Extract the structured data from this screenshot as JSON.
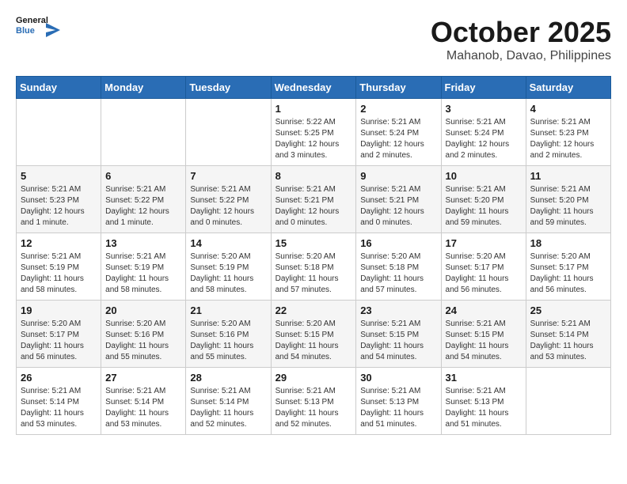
{
  "logo": {
    "line1": "General",
    "line2": "Blue"
  },
  "header": {
    "month": "October 2025",
    "location": "Mahanob, Davao, Philippines"
  },
  "weekdays": [
    "Sunday",
    "Monday",
    "Tuesday",
    "Wednesday",
    "Thursday",
    "Friday",
    "Saturday"
  ],
  "weeks": [
    [
      {
        "day": "",
        "info": ""
      },
      {
        "day": "",
        "info": ""
      },
      {
        "day": "",
        "info": ""
      },
      {
        "day": "1",
        "info": "Sunrise: 5:22 AM\nSunset: 5:25 PM\nDaylight: 12 hours and 3 minutes."
      },
      {
        "day": "2",
        "info": "Sunrise: 5:21 AM\nSunset: 5:24 PM\nDaylight: 12 hours and 2 minutes."
      },
      {
        "day": "3",
        "info": "Sunrise: 5:21 AM\nSunset: 5:24 PM\nDaylight: 12 hours and 2 minutes."
      },
      {
        "day": "4",
        "info": "Sunrise: 5:21 AM\nSunset: 5:23 PM\nDaylight: 12 hours and 2 minutes."
      }
    ],
    [
      {
        "day": "5",
        "info": "Sunrise: 5:21 AM\nSunset: 5:23 PM\nDaylight: 12 hours and 1 minute."
      },
      {
        "day": "6",
        "info": "Sunrise: 5:21 AM\nSunset: 5:22 PM\nDaylight: 12 hours and 1 minute."
      },
      {
        "day": "7",
        "info": "Sunrise: 5:21 AM\nSunset: 5:22 PM\nDaylight: 12 hours and 0 minutes."
      },
      {
        "day": "8",
        "info": "Sunrise: 5:21 AM\nSunset: 5:21 PM\nDaylight: 12 hours and 0 minutes."
      },
      {
        "day": "9",
        "info": "Sunrise: 5:21 AM\nSunset: 5:21 PM\nDaylight: 12 hours and 0 minutes."
      },
      {
        "day": "10",
        "info": "Sunrise: 5:21 AM\nSunset: 5:20 PM\nDaylight: 11 hours and 59 minutes."
      },
      {
        "day": "11",
        "info": "Sunrise: 5:21 AM\nSunset: 5:20 PM\nDaylight: 11 hours and 59 minutes."
      }
    ],
    [
      {
        "day": "12",
        "info": "Sunrise: 5:21 AM\nSunset: 5:19 PM\nDaylight: 11 hours and 58 minutes."
      },
      {
        "day": "13",
        "info": "Sunrise: 5:21 AM\nSunset: 5:19 PM\nDaylight: 11 hours and 58 minutes."
      },
      {
        "day": "14",
        "info": "Sunrise: 5:20 AM\nSunset: 5:19 PM\nDaylight: 11 hours and 58 minutes."
      },
      {
        "day": "15",
        "info": "Sunrise: 5:20 AM\nSunset: 5:18 PM\nDaylight: 11 hours and 57 minutes."
      },
      {
        "day": "16",
        "info": "Sunrise: 5:20 AM\nSunset: 5:18 PM\nDaylight: 11 hours and 57 minutes."
      },
      {
        "day": "17",
        "info": "Sunrise: 5:20 AM\nSunset: 5:17 PM\nDaylight: 11 hours and 56 minutes."
      },
      {
        "day": "18",
        "info": "Sunrise: 5:20 AM\nSunset: 5:17 PM\nDaylight: 11 hours and 56 minutes."
      }
    ],
    [
      {
        "day": "19",
        "info": "Sunrise: 5:20 AM\nSunset: 5:17 PM\nDaylight: 11 hours and 56 minutes."
      },
      {
        "day": "20",
        "info": "Sunrise: 5:20 AM\nSunset: 5:16 PM\nDaylight: 11 hours and 55 minutes."
      },
      {
        "day": "21",
        "info": "Sunrise: 5:20 AM\nSunset: 5:16 PM\nDaylight: 11 hours and 55 minutes."
      },
      {
        "day": "22",
        "info": "Sunrise: 5:20 AM\nSunset: 5:15 PM\nDaylight: 11 hours and 54 minutes."
      },
      {
        "day": "23",
        "info": "Sunrise: 5:21 AM\nSunset: 5:15 PM\nDaylight: 11 hours and 54 minutes."
      },
      {
        "day": "24",
        "info": "Sunrise: 5:21 AM\nSunset: 5:15 PM\nDaylight: 11 hours and 54 minutes."
      },
      {
        "day": "25",
        "info": "Sunrise: 5:21 AM\nSunset: 5:14 PM\nDaylight: 11 hours and 53 minutes."
      }
    ],
    [
      {
        "day": "26",
        "info": "Sunrise: 5:21 AM\nSunset: 5:14 PM\nDaylight: 11 hours and 53 minutes."
      },
      {
        "day": "27",
        "info": "Sunrise: 5:21 AM\nSunset: 5:14 PM\nDaylight: 11 hours and 53 minutes."
      },
      {
        "day": "28",
        "info": "Sunrise: 5:21 AM\nSunset: 5:14 PM\nDaylight: 11 hours and 52 minutes."
      },
      {
        "day": "29",
        "info": "Sunrise: 5:21 AM\nSunset: 5:13 PM\nDaylight: 11 hours and 52 minutes."
      },
      {
        "day": "30",
        "info": "Sunrise: 5:21 AM\nSunset: 5:13 PM\nDaylight: 11 hours and 51 minutes."
      },
      {
        "day": "31",
        "info": "Sunrise: 5:21 AM\nSunset: 5:13 PM\nDaylight: 11 hours and 51 minutes."
      },
      {
        "day": "",
        "info": ""
      }
    ]
  ]
}
